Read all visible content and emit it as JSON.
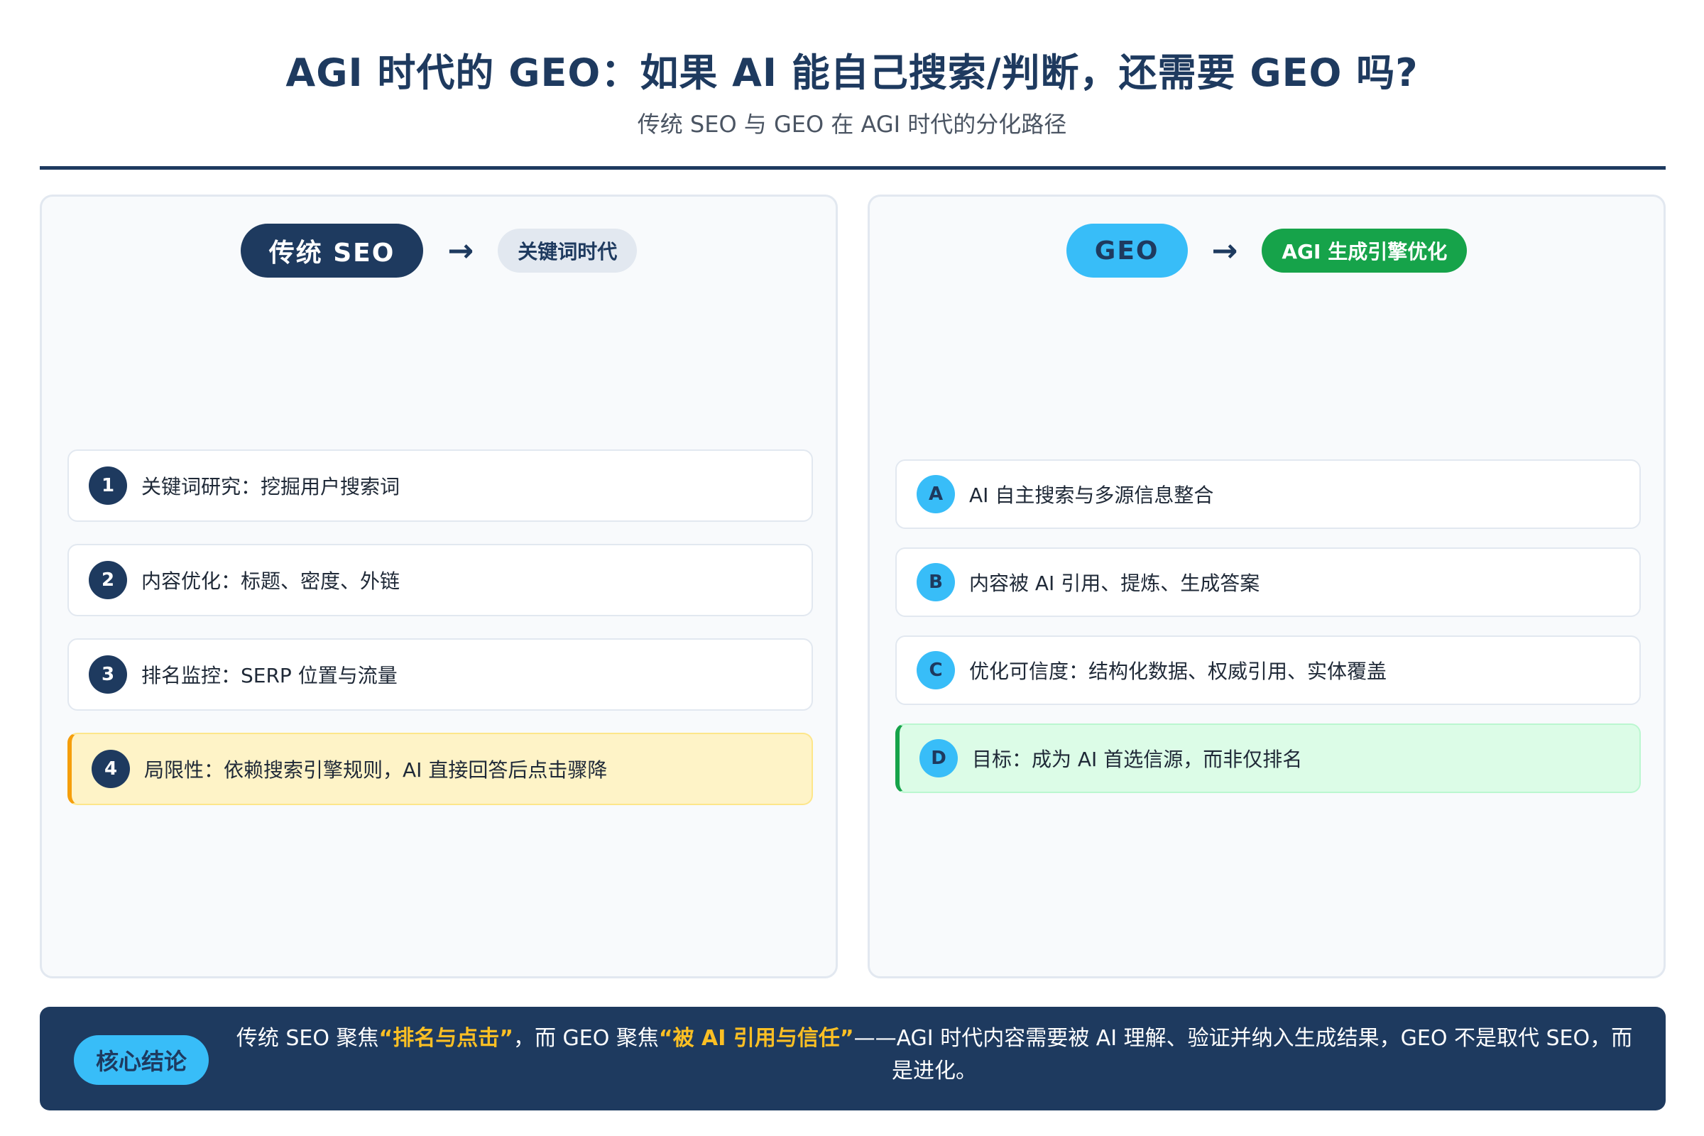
{
  "header": {
    "title": "AGI 时代的 GEO：如果 AI 能自己搜索/判断，还需要 GEO 吗?",
    "subtitle": "传统 SEO 与 GEO 在 AGI 时代的分化路径"
  },
  "left_panel": {
    "main_label": "传统 SEO",
    "arrow": "→",
    "sub_label": "关键词时代",
    "items": [
      {
        "badge": "1",
        "text": "关键词研究：挖掘用户搜索词"
      },
      {
        "badge": "2",
        "text": "内容优化：标题、密度、外链"
      },
      {
        "badge": "3",
        "text": "排名监控：SERP 位置与流量"
      },
      {
        "badge": "4",
        "text": "局限性：依赖搜索引擎规则，AI 直接回答后点击骤降"
      }
    ]
  },
  "right_panel": {
    "main_label": "GEO",
    "arrow": "→",
    "sub_label": "AGI 生成引擎优化",
    "items": [
      {
        "badge": "A",
        "text": "AI 自主搜索与多源信息整合"
      },
      {
        "badge": "B",
        "text": "内容被 AI 引用、提炼、生成答案"
      },
      {
        "badge": "C",
        "text": "优化可信度：结构化数据、权威引用、实体覆盖"
      },
      {
        "badge": "D",
        "text": "目标：成为 AI 首选信源，而非仅排名"
      }
    ]
  },
  "conclusion": {
    "tag": "核心结论",
    "part1": "传统 SEO 聚焦",
    "highlight1": "“排名与点击”",
    "part2": "，而 GEO 聚焦",
    "highlight2": "“被 AI 引用与信任”",
    "part3": "——AGI 时代内容需要被 AI 理解、验证并纳入生成结果，GEO 不是取代 SEO，而是进化。"
  },
  "colors": {
    "navy": "#1e3a5f",
    "sky": "#38bdf8",
    "green": "#16a34a",
    "warning_bg": "#fef3c7",
    "warning_border": "#f59e0b",
    "success_bg": "#dcfce7",
    "highlight": "#fbbf24"
  }
}
